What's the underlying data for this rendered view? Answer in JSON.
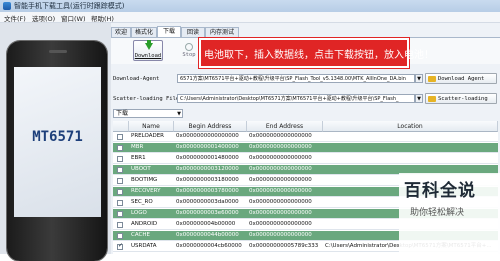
{
  "window": {
    "title": "智能手机下载工具(运行时跟踪模式)"
  },
  "menu": [
    "文件(F)",
    "选项(O)",
    "窗口(W)",
    "帮助(H)"
  ],
  "phone": {
    "model": "MT6571"
  },
  "tabs": [
    {
      "label": "欢迎",
      "active": false
    },
    {
      "label": "格式化",
      "active": false
    },
    {
      "label": "下载",
      "active": true
    },
    {
      "label": "回读",
      "active": false
    },
    {
      "label": "内存测试",
      "active": false
    }
  ],
  "toolbar": {
    "download_label": "Download",
    "stop_label": "Stop"
  },
  "annotation": {
    "text": "电池取下，插入数据线，点击下载按钮，放入电池！",
    "color": "#e02525"
  },
  "download_agent": {
    "label": "Download-Agent",
    "value": "6571方案\\MT6571平台+驱动+教程\\升级平台\\SP_Flash_Tool_v5.1348.00\\MTK_AllInOne_DA.bin",
    "button": "Download Agent"
  },
  "scatter": {
    "label": "Scatter-loading File",
    "value": "C:\\Users\\Administrator\\Desktop\\MT6571方案\\MT6571平台+驱动+教程\\升级平台\\SP_Flash_",
    "button": "Scatter-loading"
  },
  "mode_select": {
    "value": "下载"
  },
  "table": {
    "columns": [
      "",
      "Name",
      "Begin Address",
      "End Address",
      "Location"
    ],
    "rows": [
      {
        "checked": false,
        "name": "PRELOADER",
        "begin": "0x0000000000000000",
        "end": "0x0000000000000000",
        "location": "",
        "style": "white"
      },
      {
        "checked": false,
        "name": "MBR",
        "begin": "0x0000000001400000",
        "end": "0x0000000000000000",
        "location": "",
        "style": "green"
      },
      {
        "checked": false,
        "name": "EBR1",
        "begin": "0x0000000001480000",
        "end": "0x0000000000000000",
        "location": "",
        "style": "white"
      },
      {
        "checked": false,
        "name": "UBOOT",
        "begin": "0x0000000003120000",
        "end": "0x0000000000000000",
        "location": "",
        "style": "green"
      },
      {
        "checked": false,
        "name": "BOOTIMG",
        "begin": "0x0000000003180000",
        "end": "0x0000000000000000",
        "location": "",
        "style": "white"
      },
      {
        "checked": false,
        "name": "RECOVERY",
        "begin": "0x0000000003780000",
        "end": "0x0000000000000000",
        "location": "",
        "style": "green"
      },
      {
        "checked": false,
        "name": "SEC_RO",
        "begin": "0x0000000003da0000",
        "end": "0x0000000000000000",
        "location": "",
        "style": "white"
      },
      {
        "checked": false,
        "name": "LOGO",
        "begin": "0x0000000003e60000",
        "end": "0x0000000000000000",
        "location": "",
        "style": "green"
      },
      {
        "checked": false,
        "name": "ANDROID",
        "begin": "0x000000004b00000",
        "end": "0x0000000000000000",
        "location": "",
        "style": "white"
      },
      {
        "checked": false,
        "name": "CACHE",
        "begin": "0x0000000044b00000",
        "end": "0x0000000000000000",
        "location": "",
        "style": "green"
      },
      {
        "checked": true,
        "name": "USRDATA",
        "begin": "0x0000000004cb60000",
        "end": "0x00000000005789c333",
        "location": "C:\\Users\\Administrator\\Desktop\\MT6571方案\\MT6571平台+...",
        "style": "white"
      }
    ]
  },
  "watermark": {
    "title": "百科全说",
    "subtitle": "助你轻松解决"
  }
}
